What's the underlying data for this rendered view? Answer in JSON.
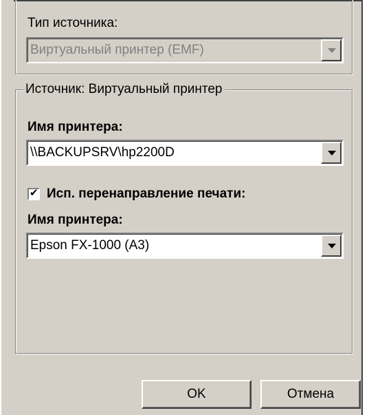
{
  "source_type": {
    "label": "Тип источника:",
    "selected": "Виртуальный принтер (EMF)"
  },
  "source": {
    "group_title": "Источник: Виртуальный принтер",
    "printer_label": "Имя принтера:",
    "printer_value": "\\\\BACKUPSRV\\hp2200D",
    "redirect_label": "Исп. перенаправление печати:",
    "redirect_checked": true,
    "redirect_printer_label": "Имя принтера:",
    "redirect_printer_value": "Epson FX-1000 (A3)"
  },
  "buttons": {
    "ok": "OK",
    "cancel": "Отмена"
  }
}
